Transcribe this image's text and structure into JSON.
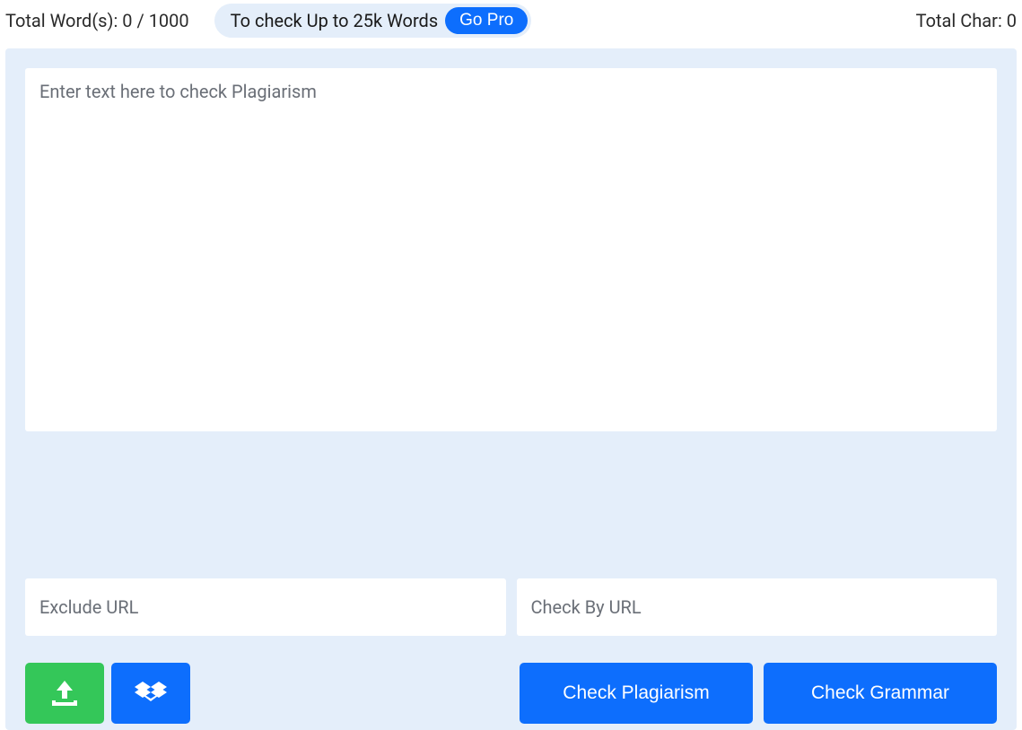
{
  "topbar": {
    "word_count_label": "Total Word(s): 0 / 1000",
    "promo_text": "To check Up to 25k Words",
    "go_pro_label": "Go Pro",
    "char_count_label": "Total Char: 0"
  },
  "editor": {
    "placeholder": "Enter text here to check Plagiarism"
  },
  "urls": {
    "exclude_placeholder": "Exclude URL",
    "checkby_placeholder": "Check By URL"
  },
  "actions": {
    "check_plagiarism_label": "Check Plagiarism",
    "check_grammar_label": "Check Grammar"
  }
}
